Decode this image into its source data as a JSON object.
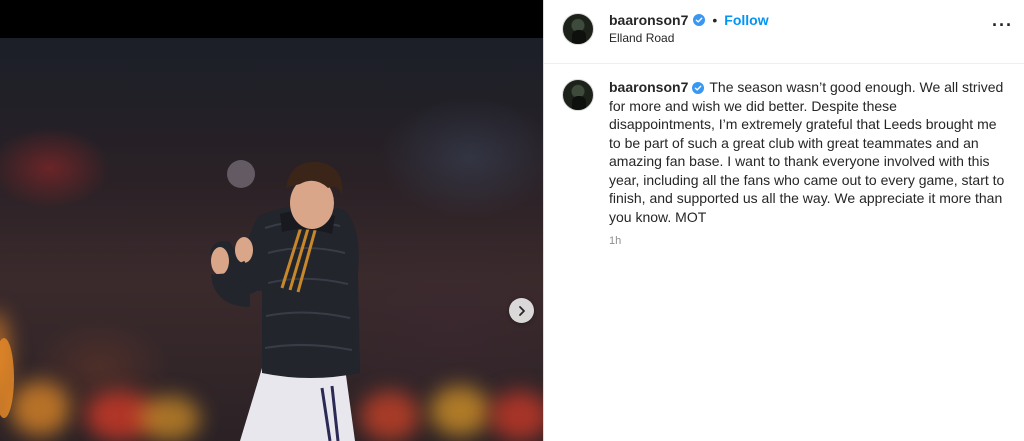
{
  "post": {
    "username": "baaronson7",
    "follow_label": "Follow",
    "separator": "•",
    "location": "Elland Road",
    "more_icon": "more-horizontal-icon",
    "caption": "The season wasn’t good enough. We all strived for more and wish we did better. Despite these disappointments, I’m extremely grateful that Leeds brought me to be part of such a great club with great teammates and an amazing fan base. I want to thank everyone involved with this year, including all the fans who came out to every game, start to finish, and supported us all the way. We appreciate it more than you know. MOT",
    "timestamp": "1h",
    "verified_icon": "verified-badge-icon",
    "next_icon": "chevron-right-icon"
  },
  "colors": {
    "accent": "#0095f6",
    "verified": "#3897f0",
    "text": "#262626",
    "muted": "#8e8e8e"
  }
}
